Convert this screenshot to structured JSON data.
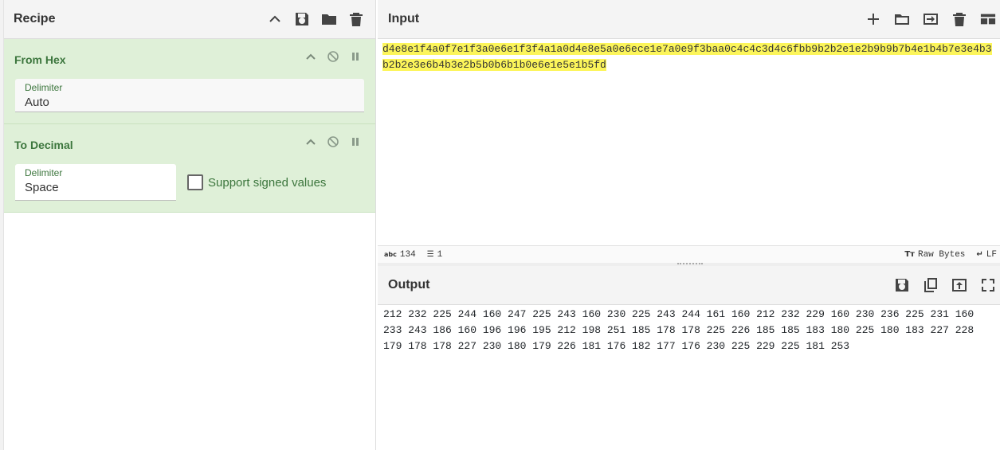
{
  "recipe": {
    "title": "Recipe",
    "icons": [
      "chevron-up-icon",
      "save-icon",
      "folder-icon",
      "trash-icon"
    ],
    "operations": [
      {
        "name": "From Hex",
        "delimiter_label": "Delimiter",
        "delimiter_value": "Auto"
      },
      {
        "name": "To Decimal",
        "delimiter_label": "Delimiter",
        "delimiter_value": "Space",
        "checkbox_label": "Support signed values",
        "checkbox_checked": false
      }
    ]
  },
  "input": {
    "title": "Input",
    "text": "d4e8e1f4a0f7e1f3a0e6e1f3f4a1a0d4e8e5a0e6ece1e7a0e9f3baa0c4c4c3d4c6fbb9b2b2e1e2b9b9b7b4e1b4b7e3e4b3b2b2e3e6b4b3e2b5b0b6b1b0e6e1e5e1b5fd",
    "highlight_color": "#fcf55a",
    "status": {
      "length": "134",
      "lines": "1",
      "encoding": "Raw Bytes",
      "eol": "LF"
    }
  },
  "output": {
    "title": "Output",
    "text": "212 232 225 244 160 247 225 243 160 230 225 243 244 161 160 212 232 229 160 230 236 225 231 160 233 243 186 160 196 196 195 212 198 251 185 178 178 225 226 185 185 183 180 225 180 183 227 228 179 178 178 227 230 180 179 226 181 176 182 177 176 230 225 229 225 181 253"
  },
  "colors": {
    "op_background": "#dff0d8",
    "op_text": "#3c763d"
  }
}
